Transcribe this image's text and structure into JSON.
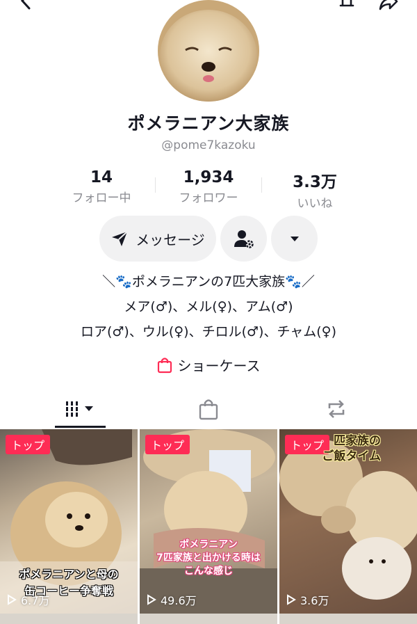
{
  "header": {
    "back_icon": "chevron-left-icon",
    "bell_icon": "bell-icon",
    "share_icon": "share-arrow-icon"
  },
  "profile": {
    "display_name": "ポメラニアン大家族",
    "handle": "@pome7kazoku"
  },
  "stats": [
    {
      "value": "14",
      "label": "フォロー中"
    },
    {
      "value": "1,934",
      "label": "フォロワー"
    },
    {
      "value": "3.3万",
      "label": "いいね"
    }
  ],
  "actions": {
    "message_label": "メッセージ",
    "message_icon": "send-icon",
    "friends_icon": "user-settings-icon",
    "dropdown_icon": "caret-down-icon"
  },
  "bio": [
    "＼🐾ポメラニアンの7匹大家族🐾／",
    "メア(♂)、メル(♀)、アム(♂)",
    "ロア(♂)、ウル(♀)、チロル(♂)、チャム(♀)"
  ],
  "showcase": {
    "label": "ショーケース",
    "icon": "shopping-bag-icon"
  },
  "tabs": [
    {
      "name": "videos",
      "icon": "grid-icon"
    },
    {
      "name": "shop",
      "icon": "shopping-bag-icon"
    },
    {
      "name": "reposts",
      "icon": "repost-icon"
    }
  ],
  "videos": [
    {
      "badge": "トップ",
      "caption": [
        "ポメラニアンと母の",
        "缶コーヒー争奪戦"
      ],
      "views": "6.7万"
    },
    {
      "badge": "トップ",
      "caption": [
        "ポメラニアン",
        "7匹家族と出かける時は",
        "こんな感じ"
      ],
      "views": "49.6万"
    },
    {
      "badge": "トップ",
      "caption": [
        "匹家族の",
        "ご飯タイム"
      ],
      "views": "3.6万"
    }
  ],
  "colors": {
    "accent": "#fe2c55",
    "text": "#161823",
    "muted": "#8a8b91",
    "button_bg": "#f1f1f2"
  }
}
